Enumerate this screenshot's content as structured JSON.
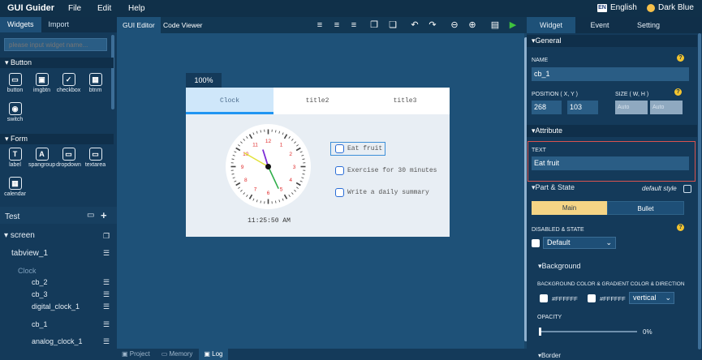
{
  "app": {
    "title": "GUI Guider",
    "menus": [
      "File",
      "Edit",
      "Help"
    ],
    "language": "English",
    "language_flag": "EN",
    "theme": "Dark Blue"
  },
  "left": {
    "tabs": [
      "Widgets",
      "Import"
    ],
    "search_placeholder": "please input widget name...",
    "sections": {
      "button": "Button",
      "form": "Form"
    },
    "button_widgets": [
      {
        "label": "button",
        "icon": "button-icon",
        "glyph": "▭"
      },
      {
        "label": "imgbtn",
        "icon": "image-button-icon",
        "glyph": "▣"
      },
      {
        "label": "checkbox",
        "icon": "checkbox-icon",
        "glyph": "✓"
      },
      {
        "label": "btnm",
        "icon": "button-matrix-icon",
        "glyph": "▦"
      },
      {
        "label": "switch",
        "icon": "switch-icon",
        "glyph": "◉"
      }
    ],
    "form_widgets": [
      {
        "label": "label",
        "icon": "label-icon",
        "glyph": "T"
      },
      {
        "label": "spangroup",
        "icon": "spangroup-icon",
        "glyph": "A"
      },
      {
        "label": "dropdown",
        "icon": "dropdown-icon",
        "glyph": "▭"
      },
      {
        "label": "textarea",
        "icon": "textarea-icon",
        "glyph": "▭"
      },
      {
        "label": "calendar",
        "icon": "calendar-icon",
        "glyph": "▦"
      }
    ],
    "tree_title": "Test",
    "tree": {
      "screen": "screen",
      "tabview": "tabview_1",
      "clock_tab": "Clock",
      "cb_2": "cb_2",
      "cb_3": "cb_3",
      "digital_clock": "digital_clock_1",
      "cb_1": "cb_1",
      "analog_clock": "analog_clock_1"
    }
  },
  "center": {
    "tabs": [
      "GUI Editor",
      "Code Viewer"
    ],
    "zoom": "100%",
    "tabview_tabs": [
      "Clock",
      "title2",
      "title3"
    ],
    "clock_numbers": [
      "12",
      "1",
      "2",
      "3",
      "4",
      "5",
      "6",
      "7",
      "8",
      "9",
      "10",
      "11"
    ],
    "clock_time": {
      "hour": 11,
      "minute": 25,
      "second": 50
    },
    "digital_time": "11:25:50 AM",
    "checkboxes": [
      "Eat fruit",
      "Exercise for 30 minutes",
      "Write a daily summary"
    ],
    "bottom_tabs": [
      "Project",
      "Memory",
      "Log"
    ]
  },
  "right": {
    "tabs": [
      "Widget",
      "Event",
      "Setting"
    ],
    "general_label": "▾General",
    "name_label": "NAME",
    "name_value": "cb_1",
    "position_label": "POSITION ( X, Y )",
    "pos_x": "268",
    "pos_y": "103",
    "size_label": "SIZE ( W, H )",
    "size_w": "Auto",
    "size_h": "Auto",
    "attribute_label": "▾Attribute",
    "text_label": "TEXT",
    "text_value": "Eat fruit",
    "part_state_label": "▾Part & State",
    "default_style": "default style",
    "part_main": "Main",
    "part_bullet": "Bullet",
    "disabled_state_label": "DISABLED & STATE",
    "state_value": "Default",
    "background_label": "▾Background",
    "bg_color_label": "BACKGROUND COLOR & GRADIENT COLOR & DIRECTION",
    "bg_color": "#FFFFFF",
    "grad_color": "#FFFFFF",
    "direction": "vertical",
    "opacity_label": "OPACITY",
    "opacity_value": "0%",
    "border_label": "▾Border"
  }
}
